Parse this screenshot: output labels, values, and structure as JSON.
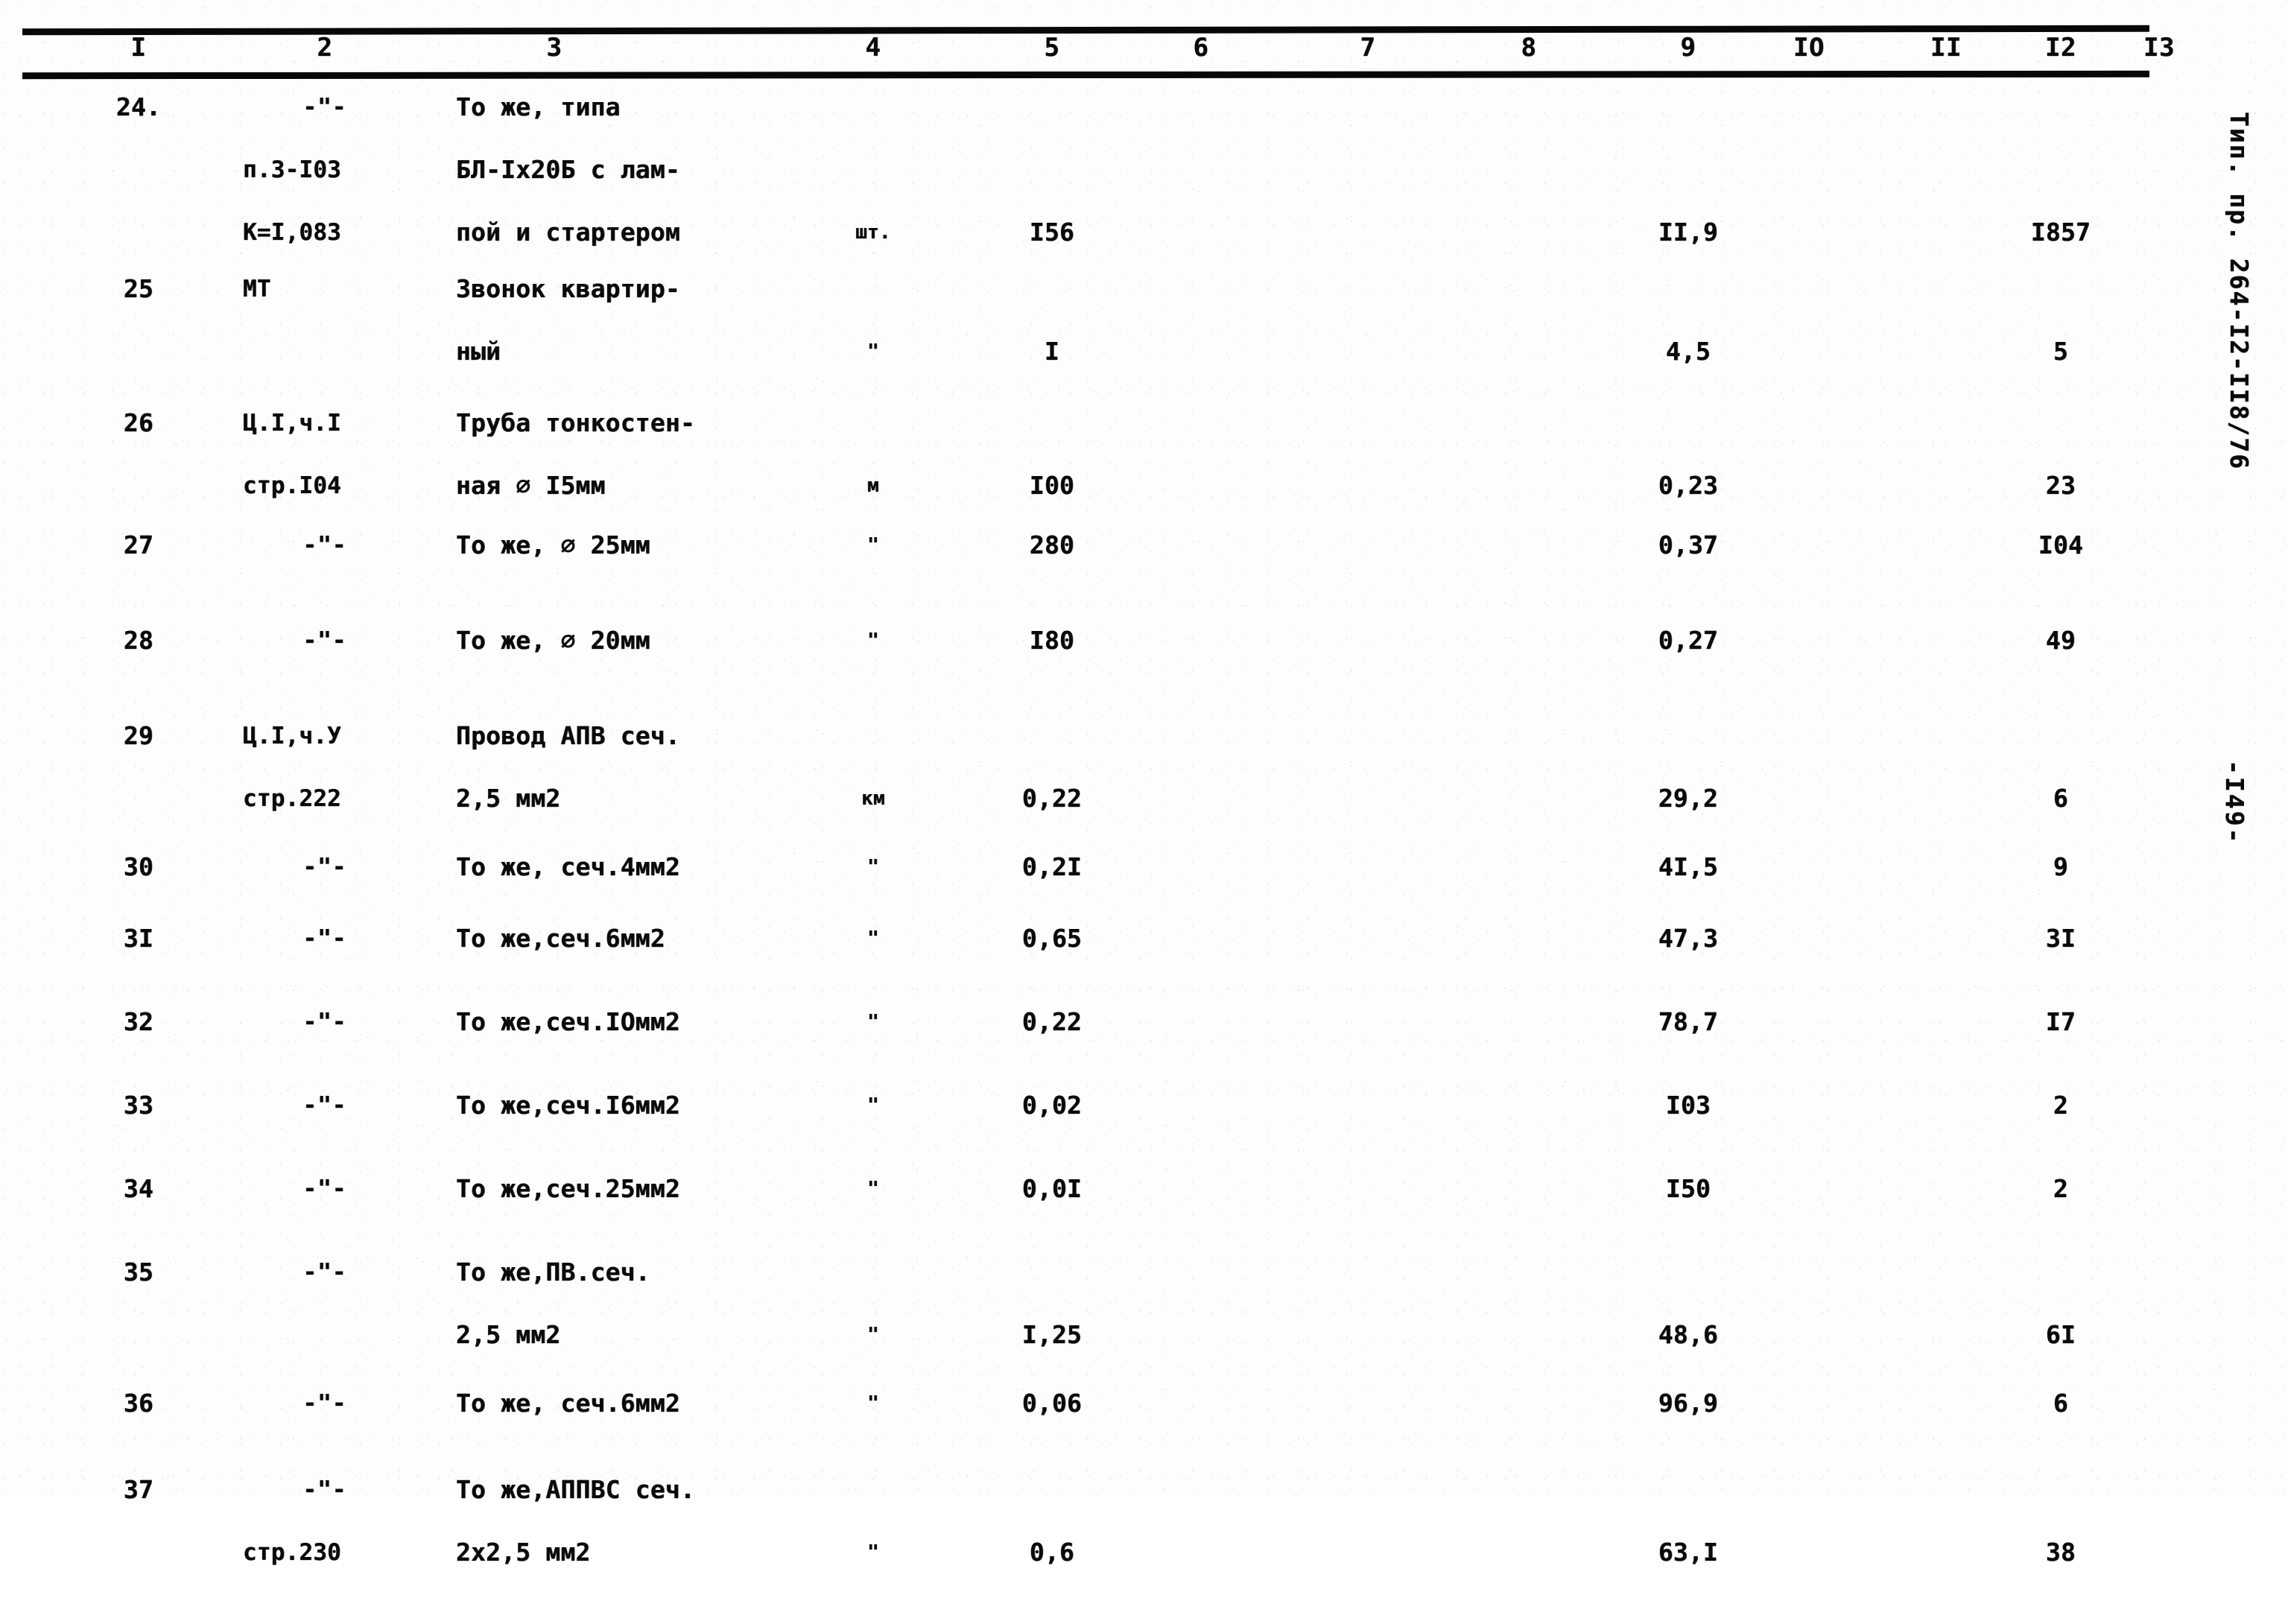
{
  "document": {
    "type": "specification-table",
    "column_headers": [
      "I",
      "2",
      "3",
      "4",
      "5",
      "6",
      "7",
      "8",
      "9",
      "IO",
      "II",
      "I2",
      "I3"
    ],
    "margin": {
      "project_code": "Тип. пр. 264-I2-II8/76",
      "page_number": "-I49-"
    }
  },
  "rows": [
    {
      "num": "24.",
      "ref": [
        "-\"-",
        "п.3-I03",
        "К=I,083"
      ],
      "name": [
        "То же, типа",
        "БЛ-Iх20Б с лам-",
        "пой и стартером"
      ],
      "unit": "шт.",
      "qty": "I56",
      "c6": "",
      "c7": "",
      "c8": "",
      "price": "II,9",
      "c10": "",
      "c11": "",
      "total": "I857",
      "c13": ""
    },
    {
      "num": "25",
      "ref": [
        "МТ"
      ],
      "name": [
        "Звонок квартир-",
        "ный"
      ],
      "unit": "\"",
      "qty": "I",
      "c6": "",
      "c7": "",
      "c8": "",
      "price": "4,5",
      "c10": "",
      "c11": "",
      "total": "5",
      "c13": ""
    },
    {
      "num": "26",
      "ref": [
        "Ц.I,ч.I",
        "стр.I04"
      ],
      "name": [
        "Труба тонкостен-",
        "ная ⌀ I5мм"
      ],
      "unit": "м",
      "qty": "I00",
      "c6": "",
      "c7": "",
      "c8": "",
      "price": "0,23",
      "c10": "",
      "c11": "",
      "total": "23",
      "c13": ""
    },
    {
      "num": "27",
      "ref": [
        "-\"-"
      ],
      "name": [
        "То же, ⌀ 25мм"
      ],
      "unit": "\"",
      "qty": "280",
      "c6": "",
      "c7": "",
      "c8": "",
      "price": "0,37",
      "c10": "",
      "c11": "",
      "total": "I04",
      "c13": ""
    },
    {
      "num": "28",
      "ref": [
        "-\"-"
      ],
      "name": [
        "То же, ⌀ 20мм"
      ],
      "unit": "\"",
      "qty": "I80",
      "c6": "",
      "c7": "",
      "c8": "",
      "price": "0,27",
      "c10": "",
      "c11": "",
      "total": "49",
      "c13": ""
    },
    {
      "num": "29",
      "ref": [
        "Ц.I,ч.У",
        "стр.222"
      ],
      "name": [
        "Провод АПВ сеч.",
        "2,5 мм2"
      ],
      "unit": "км",
      "qty": "0,22",
      "c6": "",
      "c7": "",
      "c8": "",
      "price": "29,2",
      "c10": "",
      "c11": "",
      "total": "6",
      "c13": ""
    },
    {
      "num": "30",
      "ref": [
        "-\"-"
      ],
      "name": [
        "То же, сеч.4мм2"
      ],
      "unit": "\"",
      "qty": "0,2I",
      "c6": "",
      "c7": "",
      "c8": "",
      "price": "4I,5",
      "c10": "",
      "c11": "",
      "total": "9",
      "c13": ""
    },
    {
      "num": "3I",
      "ref": [
        "-\"-"
      ],
      "name": [
        "То же,сеч.6мм2"
      ],
      "unit": "\"",
      "qty": "0,65",
      "c6": "",
      "c7": "",
      "c8": "",
      "price": "47,3",
      "c10": "",
      "c11": "",
      "total": "3I",
      "c13": ""
    },
    {
      "num": "32",
      "ref": [
        "-\"-"
      ],
      "name": [
        "То же,сеч.IОмм2"
      ],
      "unit": "\"",
      "qty": "0,22",
      "c6": "",
      "c7": "",
      "c8": "",
      "price": "78,7",
      "c10": "",
      "c11": "",
      "total": "I7",
      "c13": ""
    },
    {
      "num": "33",
      "ref": [
        "-\"-"
      ],
      "name": [
        "То же,сеч.I6мм2"
      ],
      "unit": "\"",
      "qty": "0,02",
      "c6": "",
      "c7": "",
      "c8": "",
      "price": "I03",
      "c10": "",
      "c11": "",
      "total": "2",
      "c13": ""
    },
    {
      "num": "34",
      "ref": [
        "-\"-"
      ],
      "name": [
        "То же,сеч.25мм2"
      ],
      "unit": "\"",
      "qty": "0,0I",
      "c6": "",
      "c7": "",
      "c8": "",
      "price": "I50",
      "c10": "",
      "c11": "",
      "total": "2",
      "c13": ""
    },
    {
      "num": "35",
      "ref": [
        "-\"-"
      ],
      "name": [
        "То же,ПВ.сеч.",
        "2,5 мм2"
      ],
      "unit": "\"",
      "qty": "I,25",
      "c6": "",
      "c7": "",
      "c8": "",
      "price": "48,6",
      "c10": "",
      "c11": "",
      "total": "6I",
      "c13": ""
    },
    {
      "num": "36",
      "ref": [
        "-\"-"
      ],
      "name": [
        "То же, сеч.6мм2"
      ],
      "unit": "\"",
      "qty": "0,06",
      "c6": "",
      "c7": "",
      "c8": "",
      "price": "96,9",
      "c10": "",
      "c11": "",
      "total": "6",
      "c13": ""
    },
    {
      "num": "37",
      "ref": [
        "-\"-",
        "стр.230"
      ],
      "name": [
        "То же,АППВС сеч.",
        "2х2,5 мм2"
      ],
      "unit": "\"",
      "qty": "0,6",
      "c6": "",
      "c7": "",
      "c8": "",
      "price": "63,I",
      "c10": "",
      "c11": "",
      "total": "38",
      "c13": ""
    }
  ]
}
